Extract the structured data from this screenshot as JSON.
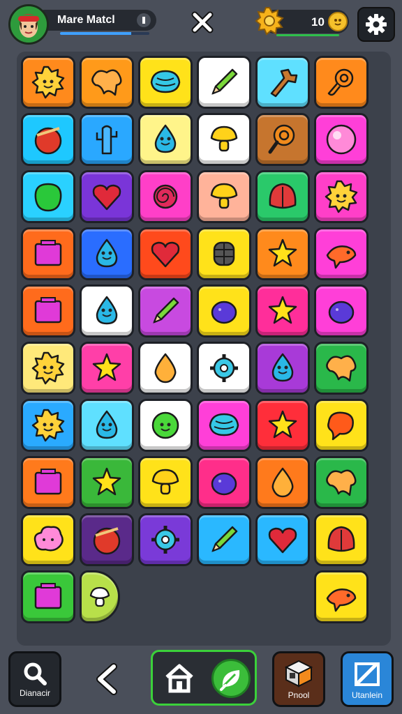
{
  "header": {
    "player_name": "Mare Matcl",
    "xp_progress_percent": 80,
    "coins": "10"
  },
  "board": {
    "columns": 6,
    "rows": 10,
    "tiles": [
      {
        "color": "#ff8a1c",
        "shape": "sun-face"
      },
      {
        "color": "#ff9a1a",
        "shape": "blob"
      },
      {
        "color": "#ffe21a",
        "shape": "shell"
      },
      {
        "color": "#ffffff",
        "shape": "pencil"
      },
      {
        "color": "#5fe0ff",
        "shape": "bone"
      },
      {
        "color": "#ff8a1c",
        "shape": "swirl"
      },
      {
        "color": "#1ec8ff",
        "shape": "ball"
      },
      {
        "color": "#2aa8ff",
        "shape": "cactus"
      },
      {
        "color": "#fff48a",
        "shape": "drop-face"
      },
      {
        "color": "#ffffff",
        "shape": "mushroom"
      },
      {
        "color": "#c6752e",
        "shape": "magnifier"
      },
      {
        "color": "#ff3fd8",
        "shape": "bubble"
      },
      {
        "color": "#2ad1ff",
        "shape": "gem"
      },
      {
        "color": "#7a35d8",
        "shape": "heart"
      },
      {
        "color": "#ff3fc8",
        "shape": "rose"
      },
      {
        "color": "#ffb39a",
        "shape": "mushroom"
      },
      {
        "color": "#2ac96a",
        "shape": "leaf"
      },
      {
        "color": "#ff3fc8",
        "shape": "sun-face"
      },
      {
        "color": "#ff6b1c",
        "shape": "square"
      },
      {
        "color": "#2a6dff",
        "shape": "drop-face"
      },
      {
        "color": "#ff4a1c",
        "shape": "heart"
      },
      {
        "color": "#ffe21a",
        "shape": "grenade"
      },
      {
        "color": "#ff8a1c",
        "shape": "star"
      },
      {
        "color": "#ff3fd8",
        "shape": "fish"
      },
      {
        "color": "#ff6b1c",
        "shape": "square"
      },
      {
        "color": "#ffffff",
        "shape": "drop-face"
      },
      {
        "color": "#c84ae0",
        "shape": "pencil"
      },
      {
        "color": "#ffe21a",
        "shape": "berry"
      },
      {
        "color": "#ff2e9a",
        "shape": "star"
      },
      {
        "color": "#ff3fd8",
        "shape": "berry"
      },
      {
        "color": "#ffe97a",
        "shape": "sun-face"
      },
      {
        "color": "#ff3fa8",
        "shape": "star"
      },
      {
        "color": "#ffffff",
        "shape": "drop"
      },
      {
        "color": "#ffffff",
        "shape": "gear"
      },
      {
        "color": "#a83ad8",
        "shape": "drop-face"
      },
      {
        "color": "#2ab84a",
        "shape": "blob"
      },
      {
        "color": "#2aaaff",
        "shape": "sun-face"
      },
      {
        "color": "#5fe0ff",
        "shape": "drop-face"
      },
      {
        "color": "#ffffff",
        "shape": "ball-face"
      },
      {
        "color": "#ff3fd8",
        "shape": "shell"
      },
      {
        "color": "#ff2e3a",
        "shape": "star"
      },
      {
        "color": "#ffe21a",
        "shape": "balloon"
      },
      {
        "color": "#ff7a1c",
        "shape": "square"
      },
      {
        "color": "#3ab83a",
        "shape": "star"
      },
      {
        "color": "#ffe21a",
        "shape": "mushroom"
      },
      {
        "color": "#ff2e8a",
        "shape": "berry"
      },
      {
        "color": "#ff7a1c",
        "shape": "drop"
      },
      {
        "color": "#2ab84a",
        "shape": "blob"
      },
      {
        "color": "#ffe21a",
        "shape": "cloud"
      },
      {
        "color": "#5a2a8a",
        "shape": "ball"
      },
      {
        "color": "#7a3ad8",
        "shape": "gear"
      },
      {
        "color": "#2ab8ff",
        "shape": "pencil"
      },
      {
        "color": "#2ab8ff",
        "shape": "heart"
      },
      {
        "color": "#ffe21a",
        "shape": "leaf"
      },
      {
        "color": "#3ac83a",
        "shape": "square"
      },
      {
        "color": "#b8e04a",
        "shape": "mushroom-half"
      },
      {
        "color": "",
        "shape": "empty"
      },
      {
        "color": "",
        "shape": "empty"
      },
      {
        "color": "",
        "shape": "empty"
      },
      {
        "color": "#ffe21a",
        "shape": "fish"
      }
    ]
  },
  "footer": {
    "left_label": "Dianacir",
    "right1_label": "Pnool",
    "right2_label": "Utanlein"
  }
}
